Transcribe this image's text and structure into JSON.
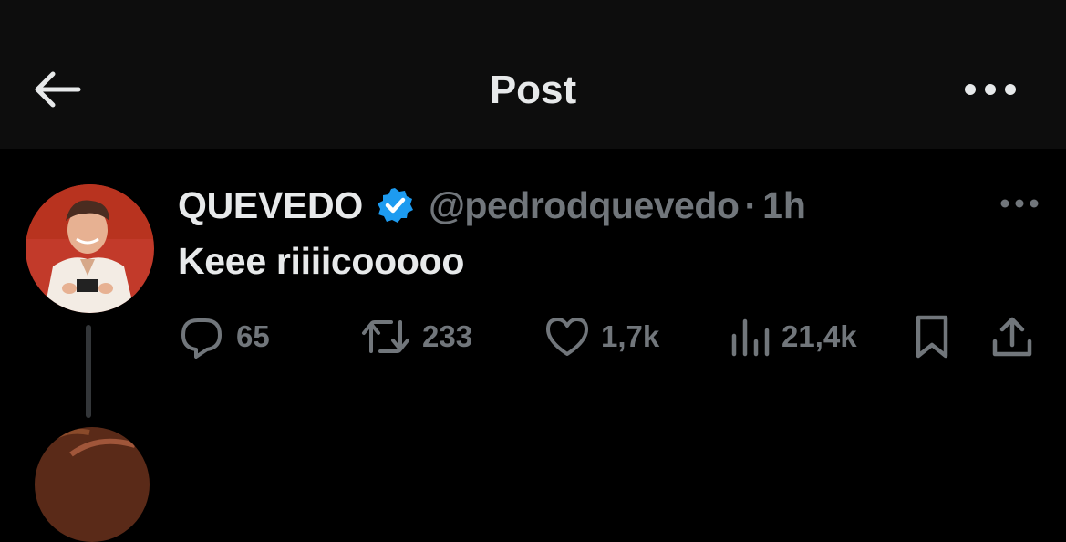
{
  "header": {
    "title": "Post",
    "back_icon": "arrow-left-icon",
    "more_icon": "more-horizontal-icon"
  },
  "post": {
    "display_name": "QUEVEDO",
    "verified": true,
    "handle": "@pedrodquevedo",
    "separator": "·",
    "time": "1h",
    "text": "Keee riiiicooooo",
    "actions": {
      "replies": "65",
      "reposts": "233",
      "likes": "1,7k",
      "views": "21,4k"
    }
  },
  "colors": {
    "background": "#000000",
    "header_bg": "#0d0d0d",
    "text_primary": "#e7e9ea",
    "text_secondary": "#71767b",
    "verified_blue": "#1d9bf0",
    "avatar_bg": "#c23a2a"
  }
}
